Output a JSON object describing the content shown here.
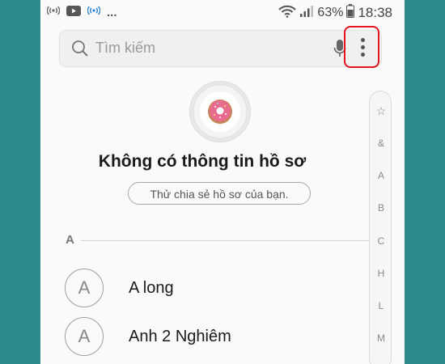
{
  "status_bar": {
    "left_dots": "...",
    "battery_percent": "63%",
    "time": "18:38"
  },
  "search": {
    "placeholder": "Tìm kiếm"
  },
  "profile": {
    "title": "Không có thông tin hồ sơ",
    "share_prompt": "Thử chia sẻ hồ sơ của bạn."
  },
  "section": {
    "letter": "A"
  },
  "contacts": [
    {
      "initial": "A",
      "name": "A long"
    },
    {
      "initial": "A",
      "name": "Anh 2 Nghiêm"
    }
  ],
  "index_bar": [
    "☆",
    "&",
    "A",
    "B",
    "C",
    "H",
    "L",
    "M"
  ],
  "colors": {
    "background": "#2e8a8c",
    "highlight_border": "#e3141c",
    "avatar_donut": "#e86a8c"
  }
}
